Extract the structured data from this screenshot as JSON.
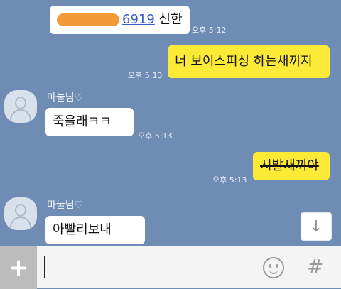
{
  "messages": {
    "m1": {
      "account_suffix": "6919",
      "bank": "신한",
      "time": "오후 5:12"
    },
    "m2": {
      "text": "너 보이스피싱 하는새끼지",
      "time": "오후 5:13"
    },
    "m3": {
      "sender": "마눌님♡",
      "text": "죽을래ㅋㅋ",
      "time": "오후 5:13"
    },
    "m4": {
      "text": "시발새끼야",
      "time": "오후 5:13"
    },
    "m5": {
      "sender": "마눌님♡",
      "text": "아빨리보내"
    }
  },
  "icons": {
    "scroll_down": "↓",
    "plus": "+",
    "hash": "#"
  },
  "input": {
    "value": "",
    "placeholder": ""
  },
  "colors": {
    "chat_bg": "#6f8cb5",
    "my_bubble": "#fdea36",
    "their_bubble": "#ffffff",
    "redaction": "#f29a3a"
  }
}
